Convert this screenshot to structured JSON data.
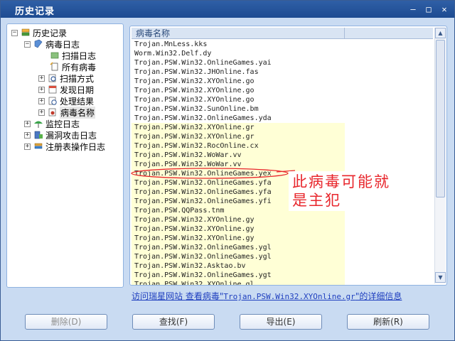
{
  "window": {
    "title": "历史记录",
    "buttons": [
      "–",
      "□",
      "✕"
    ]
  },
  "tree": {
    "root": "历史记录",
    "virus_log": "病毒日志",
    "scan_log": "扫描日志",
    "all_viruses": "所有病毒",
    "scan_method": "扫描方式",
    "discovery_date": "发现日期",
    "result": "处理结果",
    "virus_name": "病毒名称",
    "monitor_log": "监控日志",
    "vuln_attack_log": "漏洞攻击日志",
    "registry_log": "注册表操作日志"
  },
  "list": {
    "columns": [
      "病毒名称",
      ""
    ],
    "rows": [
      {
        "name": "Trojan.MnLess.kks",
        "hl": false
      },
      {
        "name": "Worm.Win32.Delf.dy",
        "hl": false
      },
      {
        "name": "Trojan.PSW.Win32.OnlineGames.yai",
        "hl": false
      },
      {
        "name": "Trojan.PSW.Win32.JHOnline.fas",
        "hl": false
      },
      {
        "name": "Trojan.PSW.Win32.XYOnline.go",
        "hl": false
      },
      {
        "name": "Trojan.PSW.Win32.XYOnline.go",
        "hl": false
      },
      {
        "name": "Trojan.PSW.Win32.XYOnline.go",
        "hl": false
      },
      {
        "name": "Trojan.PSW.Win32.SunOnline.bm",
        "hl": false
      },
      {
        "name": "Trojan.PSW.Win32.OnlineGames.yda",
        "hl": false
      },
      {
        "name": "Trojan.PSW.Win32.XYOnline.gr",
        "hl": true
      },
      {
        "name": "Trojan.PSW.Win32.XYOnline.gr",
        "hl": true
      },
      {
        "name": "Trojan.PSW.Win32.RocOnline.cx",
        "hl": true
      },
      {
        "name": "Trojan.PSW.Win32.WoWar.vv",
        "hl": true
      },
      {
        "name": "Trojan.PSW.Win32.WoWar.vv",
        "hl": true
      },
      {
        "name": "Trojan.PSW.Win32.OnlineGames.yex",
        "hl": true
      },
      {
        "name": "Trojan.PSW.Win32.OnlineGames.yfa",
        "hl": true
      },
      {
        "name": "Trojan.PSW.Win32.OnlineGames.yfa",
        "hl": true
      },
      {
        "name": "Trojan.PSW.Win32.OnlineGames.yfi",
        "hl": true
      },
      {
        "name": "Trojan.PSW.QQPass.tnm",
        "hl": true
      },
      {
        "name": "Trojan.PSW.Win32.XYOnline.gy",
        "hl": true
      },
      {
        "name": "Trojan.PSW.Win32.XYOnline.gy",
        "hl": true
      },
      {
        "name": "Trojan.PSW.Win32.XYOnline.gy",
        "hl": true
      },
      {
        "name": "Trojan.PSW.Win32.OnlineGames.ygl",
        "hl": true
      },
      {
        "name": "Trojan.PSW.Win32.OnlineGames.ygl",
        "hl": true
      },
      {
        "name": "Trojan.PSW.Win32.Asktao.bv",
        "hl": true
      },
      {
        "name": "Trojan.PSW.Win32.OnlineGames.ygt",
        "hl": true
      },
      {
        "name": "Trojan.PSW.Win32.XYOnline.gl",
        "hl": true
      }
    ]
  },
  "annotation": {
    "line1": "此病毒可能就",
    "line2": "是主犯",
    "color": "#e8262c"
  },
  "links": {
    "visit_site": "访问瑞星网站",
    "view_prefix": "查看病毒\"",
    "virus_name": "Trojan.PSW.Win32.XYOnline.gr",
    "view_suffix": "\"的详细信息"
  },
  "buttons": {
    "delete": "删除(D)",
    "find": "查找(F)",
    "export": "导出(E)",
    "refresh": "刷新(R)"
  }
}
